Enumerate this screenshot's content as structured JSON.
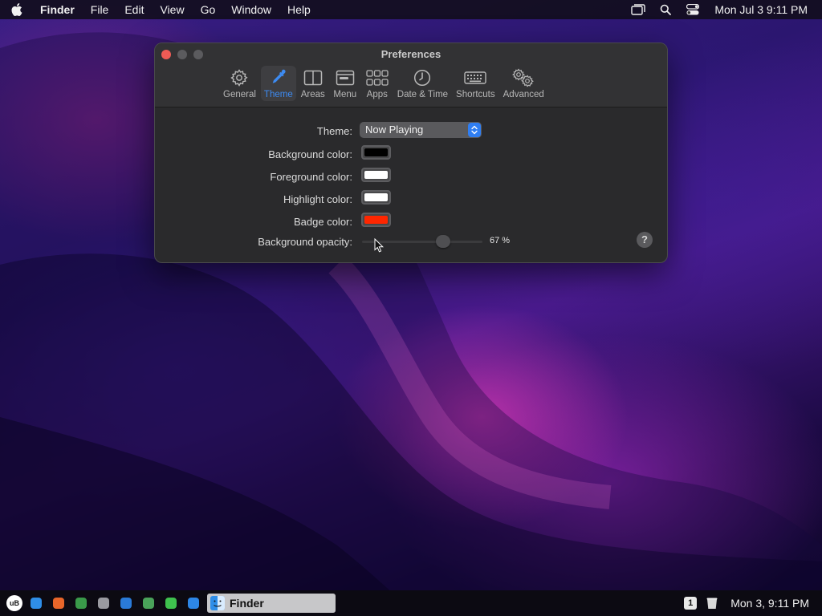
{
  "menubar": {
    "app_name": "Finder",
    "items": [
      "File",
      "Edit",
      "View",
      "Go",
      "Window",
      "Help"
    ],
    "clock": "Mon Jul 3  9:11 PM",
    "status_icons": [
      "screen-mirror-icon",
      "search-icon",
      "control-center-icon"
    ]
  },
  "window": {
    "title": "Preferences",
    "tabs": [
      {
        "label": "General",
        "icon": "gear-icon",
        "active": false
      },
      {
        "label": "Theme",
        "icon": "eyedropper-icon",
        "active": true
      },
      {
        "label": "Areas",
        "icon": "columns-icon",
        "active": false
      },
      {
        "label": "Menu",
        "icon": "menu-icon",
        "active": false
      },
      {
        "label": "Apps",
        "icon": "grid-icon",
        "active": false
      },
      {
        "label": "Date & Time",
        "icon": "clock-icon",
        "active": false
      },
      {
        "label": "Shortcuts",
        "icon": "keyboard-icon",
        "active": false
      },
      {
        "label": "Advanced",
        "icon": "gears-icon",
        "active": false
      }
    ],
    "form": {
      "theme_label": "Theme:",
      "theme_value": "Now Playing",
      "background_label": "Background color:",
      "background_color": "#000000",
      "foreground_label": "Foreground color:",
      "foreground_color": "#ffffff",
      "highlight_label": "Highlight color:",
      "highlight_color": "#ffffff",
      "badge_label": "Badge color:",
      "badge_color": "#ff2600",
      "opacity_label": "Background opacity:",
      "opacity_value": 67,
      "opacity_text": "67 %",
      "help": "?"
    }
  },
  "taskbar": {
    "launchers": [
      {
        "name": "ublock-icon",
        "text": "uB",
        "color": "#ffffff"
      },
      {
        "name": "files-icon",
        "text": "",
        "color": "#2f8ee8"
      },
      {
        "name": "firefox-icon",
        "text": "",
        "color": "#e8662a"
      },
      {
        "name": "chrome-icon",
        "text": "",
        "color": "#3a9a4a"
      },
      {
        "name": "photos-icon",
        "text": "",
        "color": "#9a9aa0"
      },
      {
        "name": "mail-icon",
        "text": "",
        "color": "#2a7ad8"
      },
      {
        "name": "maps-icon",
        "text": "",
        "color": "#4aa35a"
      },
      {
        "name": "messages-icon",
        "text": "",
        "color": "#3fc24e"
      },
      {
        "name": "appstore-icon",
        "text": "",
        "color": "#2d86e6"
      }
    ],
    "active_app": "Finder",
    "notification_count": "1",
    "clock": "Mon 3, 9:11 PM"
  }
}
